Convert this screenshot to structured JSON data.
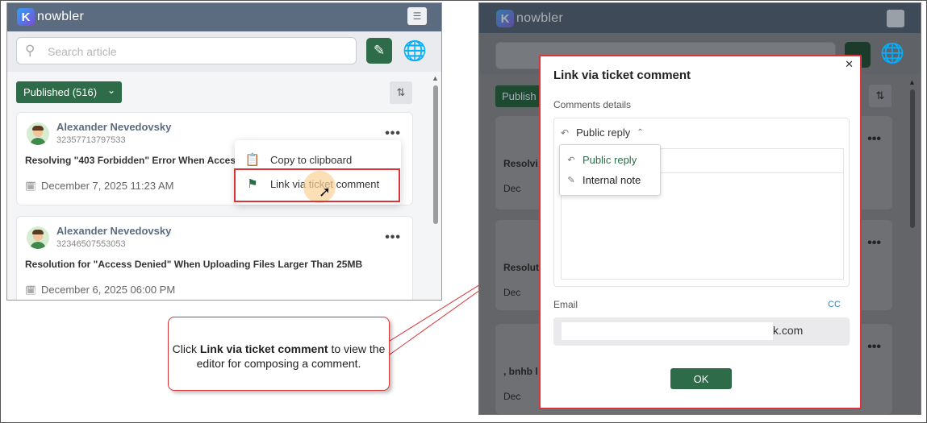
{
  "app": {
    "logo_text": "nowbler",
    "logo_letter": "K"
  },
  "left_panel": {
    "search_placeholder": "Search article",
    "published_label": "Published (516)",
    "articles": [
      {
        "author": "Alexander Nevedovsky",
        "id": "32357713797533",
        "title": "Resolving \"403 Forbidden\" Error When Acces",
        "date": "December 7, 2025 11:23 AM"
      },
      {
        "author": "Alexander Nevedovsky",
        "id": "32346507553053",
        "title": "Resolution for \"Access Denied\" When Uploading Files Larger Than 25MB",
        "date": "December 6, 2025 06:00 PM"
      }
    ],
    "context_menu": [
      {
        "label": "Copy to clipboard",
        "icon": "clipboard-icon"
      },
      {
        "label": "Link via ticket comment",
        "icon": "comment-flag-icon"
      }
    ]
  },
  "callout": {
    "prefix": "Click ",
    "bold": "Link via ticket comment",
    "suffix": " to view the editor for composing a comment."
  },
  "right_panel": {
    "published_fragment": "Publish",
    "card_fragments": [
      "Resolvi",
      "Resolut",
      ", bnhb l"
    ],
    "date_fragment": "Dec",
    "modal": {
      "title": "Link via ticket comment",
      "comments_label": "Comments details",
      "reply_selected": "Public reply",
      "options": [
        {
          "label": "Public reply",
          "icon": "reply-icon",
          "color": "#2e6b48"
        },
        {
          "label": "Internal note",
          "icon": "note-edit-icon",
          "color": "#222222"
        }
      ],
      "email_label": "Email",
      "cc_label": "CC",
      "email_visible": "k.com",
      "ok_label": "OK"
    }
  },
  "colors": {
    "accent_green": "#2e6b48",
    "highlight_red": "#d8343a",
    "topbar": "#5c6c80"
  }
}
